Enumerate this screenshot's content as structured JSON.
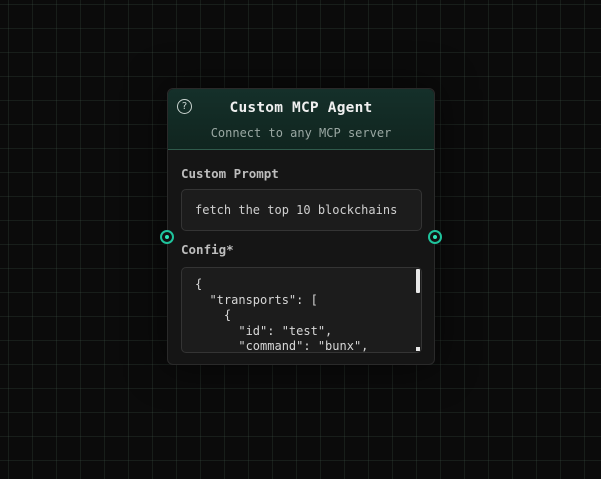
{
  "node": {
    "title": "Custom MCP Agent",
    "subtitle": "Connect to any MCP server",
    "help_icon": "?",
    "prompt": {
      "label": "Custom Prompt",
      "value": "fetch the top 10 blockchains"
    },
    "config": {
      "label": "Config*",
      "value": "{\n  \"transports\": [\n    {\n      \"id\": \"test\",\n      \"command\": \"bunx\","
    }
  },
  "colors": {
    "accent": "#1fc39c",
    "header_bg": "#15302a",
    "node_bg": "#151515"
  }
}
